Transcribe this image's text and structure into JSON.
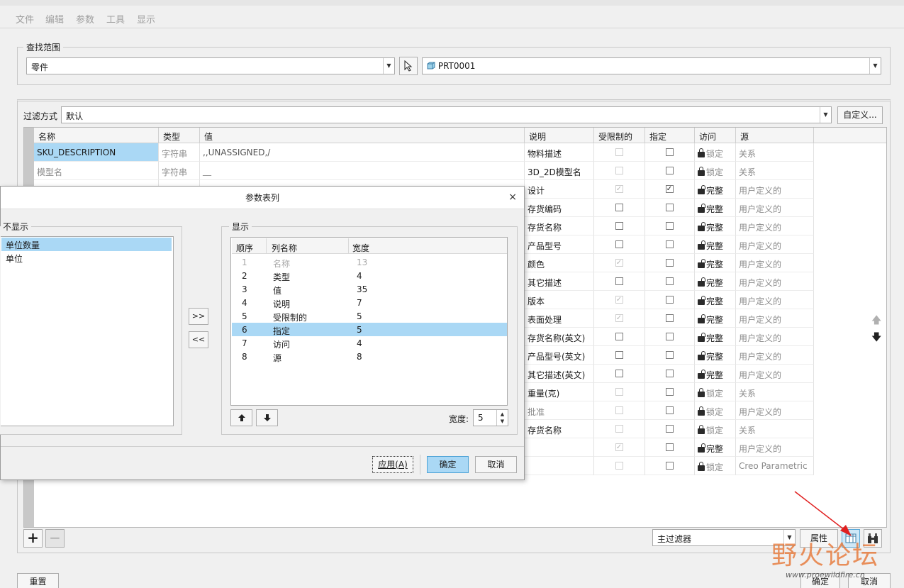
{
  "menu": [
    "文件",
    "编辑",
    "参数",
    "工具",
    "显示"
  ],
  "search_scope": {
    "legend": "查找范围",
    "type_value": "零件",
    "model_value": "PRT0001"
  },
  "filter": {
    "label": "过滤方式",
    "value": "默认",
    "custom_button": "自定义..."
  },
  "table": {
    "headers": [
      "名称",
      "类型",
      "值",
      "说明",
      "受限制的",
      "指定",
      "访问",
      "源"
    ],
    "rows": [
      {
        "name": "SKU_DESCRIPTION",
        "type": "字符串",
        "value": ",,UNASSIGNED,/",
        "desc": "物料描述",
        "restricted": "disabled",
        "designated": "off",
        "access": "锁定",
        "access_icon": "lock-icon",
        "source": "关系",
        "selected": true,
        "name_gray": false
      },
      {
        "name": "模型名",
        "type": "字符串",
        "value": "__",
        "desc": "3D_2D模型名",
        "restricted": "disabled",
        "designated": "off",
        "access": "锁定",
        "access_icon": "lock-icon",
        "source": "关系",
        "selected": false,
        "name_gray": true
      },
      {
        "name": "",
        "type": "",
        "value": "",
        "desc": "设计",
        "restricted": "disabled-checked",
        "designated": "checked",
        "access": "完整",
        "access_icon": "unlock-icon",
        "source": "用户定义的"
      },
      {
        "name": "",
        "type": "",
        "value": "",
        "desc": "存货编码",
        "restricted": "off",
        "designated": "off",
        "access": "完整",
        "access_icon": "unlock-icon",
        "source": "用户定义的"
      },
      {
        "name": "",
        "type": "",
        "value": "",
        "desc": "存货名称",
        "restricted": "off",
        "designated": "off",
        "access": "完整",
        "access_icon": "unlock-icon",
        "source": "用户定义的"
      },
      {
        "name": "",
        "type": "",
        "value": "",
        "desc": "产品型号",
        "restricted": "off",
        "designated": "off",
        "access": "完整",
        "access_icon": "unlock-icon",
        "source": "用户定义的"
      },
      {
        "name": "",
        "type": "",
        "value": "",
        "desc": "颜色",
        "restricted": "disabled-checked",
        "designated": "off",
        "access": "完整",
        "access_icon": "unlock-icon",
        "source": "用户定义的"
      },
      {
        "name": "",
        "type": "",
        "value": "",
        "desc": "其它描述",
        "restricted": "off",
        "designated": "off",
        "access": "完整",
        "access_icon": "unlock-icon",
        "source": "用户定义的"
      },
      {
        "name": "",
        "type": "",
        "value": "",
        "desc": "版本",
        "restricted": "disabled-checked",
        "designated": "off",
        "access": "完整",
        "access_icon": "unlock-icon",
        "source": "用户定义的"
      },
      {
        "name": "",
        "type": "",
        "value": "",
        "desc": "表面处理",
        "restricted": "disabled-checked",
        "designated": "off",
        "access": "完整",
        "access_icon": "unlock-icon",
        "source": "用户定义的"
      },
      {
        "name": "",
        "type": "",
        "value": "",
        "desc": "存货名称(英文)",
        "restricted": "off",
        "designated": "off",
        "access": "完整",
        "access_icon": "unlock-icon",
        "source": "用户定义的"
      },
      {
        "name": "",
        "type": "",
        "value": "",
        "desc": "产品型号(英文)",
        "restricted": "off",
        "designated": "off",
        "access": "完整",
        "access_icon": "unlock-icon",
        "source": "用户定义的"
      },
      {
        "name": "",
        "type": "",
        "value": "",
        "desc": "其它描述(英文)",
        "restricted": "off",
        "designated": "off",
        "access": "完整",
        "access_icon": "unlock-icon",
        "source": "用户定义的"
      },
      {
        "name": "",
        "type": "",
        "value": "",
        "desc": "重量(克)",
        "restricted": "disabled",
        "designated": "off",
        "access": "锁定",
        "access_icon": "lock-icon",
        "source": "关系"
      },
      {
        "name": "",
        "type": "",
        "value": "",
        "desc": "批准",
        "desc_gray": true,
        "restricted": "disabled",
        "designated": "off",
        "access": "锁定",
        "access_icon": "lock-icon",
        "source": "用户定义的"
      },
      {
        "name": "",
        "type": "",
        "value": "",
        "desc": "存货名称",
        "restricted": "disabled",
        "designated": "off",
        "access": "锁定",
        "access_icon": "lock-icon",
        "source": "关系"
      },
      {
        "name": "",
        "type": "",
        "value": "",
        "desc": "",
        "restricted": "disabled-checked",
        "designated": "off",
        "access": "完整",
        "access_icon": "unlock-icon",
        "source": "用户定义的"
      },
      {
        "name": "",
        "type": "",
        "value": "",
        "desc": "",
        "restricted": "disabled",
        "designated": "off",
        "access": "锁定",
        "access_icon": "lock-icon",
        "source": "Creo Parametric"
      }
    ]
  },
  "bottom": {
    "main_filter": "主过滤器",
    "properties_button": "属性",
    "reset_button": "重置",
    "ok_button": "确定",
    "cancel_button": "取消"
  },
  "dialog": {
    "title": "参数表列",
    "not_shown_legend": "不显示",
    "not_shown_items": [
      "单位数量",
      "单位"
    ],
    "shown_legend": "显示",
    "shown_headers": [
      "顺序",
      "列名称",
      "宽度"
    ],
    "shown_rows": [
      {
        "order": "1",
        "name": "名称",
        "width": "13",
        "disabled": true
      },
      {
        "order": "2",
        "name": "类型",
        "width": "4"
      },
      {
        "order": "3",
        "name": "值",
        "width": "35"
      },
      {
        "order": "4",
        "name": "说明",
        "width": "7"
      },
      {
        "order": "5",
        "name": "受限制的",
        "width": "5"
      },
      {
        "order": "6",
        "name": "指定",
        "width": "5",
        "selected": true
      },
      {
        "order": "7",
        "name": "访问",
        "width": "4"
      },
      {
        "order": "8",
        "name": "源",
        "width": "8"
      }
    ],
    "add_button": ">>",
    "remove_button": "<<",
    "width_label": "宽度:",
    "width_value": "5",
    "apply_button": "应用(A)",
    "ok_button": "确定",
    "cancel_button": "取消"
  },
  "watermark": {
    "title": "野火论坛",
    "url": "www.proewildfire.cn"
  }
}
